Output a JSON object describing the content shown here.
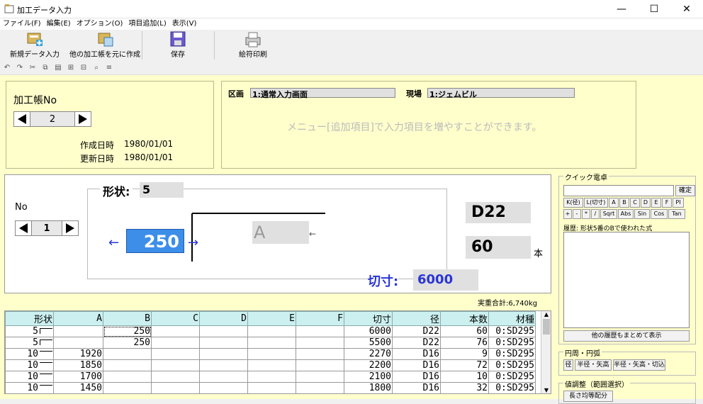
{
  "window": {
    "title": "加工データ入力",
    "minimize": "—",
    "maximize": "☐",
    "close": "✕"
  },
  "menu": [
    "ファイル(F)",
    "編集(E)",
    "オプション(O)",
    "項目追加(L)",
    "表示(V)"
  ],
  "toolbar": {
    "new": "新規データ入力",
    "copy_from": "他の加工帳を元に作成",
    "save": "保存",
    "print": "絵符印刷"
  },
  "header": {
    "label": "加工帳No",
    "number": "2",
    "created_label": "作成日時",
    "created": "1980/01/01",
    "updated_label": "更新日時",
    "updated": "1980/01/01"
  },
  "info": {
    "section_label": "区画",
    "section_value": "1:通常入力画面",
    "site_label": "現場",
    "site_value": "1:ジェムビル",
    "hint": "メニュー[追加項目]で入力項目を増やすことができます。"
  },
  "shape_editor": {
    "no_label": "No",
    "no_value": "1",
    "shape_label": "形状:",
    "shape_value": "5",
    "a_value": "250",
    "b_placeholder": "A",
    "diameter": "D22",
    "count": "60",
    "count_unit": "本",
    "cut_label": "切寸:",
    "cut_value": "6000",
    "weight_total": "実重合計:6,740kg"
  },
  "table": {
    "headers": [
      "形状",
      "A",
      "B",
      "C",
      "D",
      "E",
      "F",
      "切寸",
      "径",
      "本数",
      "材種"
    ],
    "rows": [
      [
        "5",
        "",
        "250",
        "",
        "",
        "",
        "",
        "6000",
        "D22",
        "60",
        "0:SD295"
      ],
      [
        "5",
        "",
        "250",
        "",
        "",
        "",
        "",
        "5500",
        "D22",
        "76",
        "0:SD295"
      ],
      [
        "10",
        "1920",
        "",
        "",
        "",
        "",
        "",
        "2270",
        "D16",
        "9",
        "0:SD295"
      ],
      [
        "10",
        "1850",
        "",
        "",
        "",
        "",
        "",
        "2200",
        "D16",
        "72",
        "0:SD295"
      ],
      [
        "10",
        "1700",
        "",
        "",
        "",
        "",
        "",
        "2100",
        "D16",
        "10",
        "0:SD295"
      ],
      [
        "10",
        "1450",
        "",
        "",
        "",
        "",
        "",
        "1800",
        "D16",
        "32",
        "0:SD295"
      ]
    ]
  },
  "calculator": {
    "title": "クイック電卓",
    "confirm": "確定",
    "row1": [
      "K(径)",
      "L(切寸)",
      "A",
      "B",
      "C",
      "D",
      "E",
      "F",
      "PI"
    ],
    "row2": [
      "+",
      "-",
      "*",
      "/",
      "Sqrt",
      "Abs",
      "Sin",
      "Cos",
      "Tan"
    ],
    "history_label": "履歴: 形状5番のBで使われた式",
    "show_all": "他の履歴もまとめて表示"
  },
  "circle": {
    "title": "円周・円弧",
    "buttons": [
      "径",
      "半径・矢高",
      "半径・矢高・切込"
    ]
  },
  "adjust": {
    "title": "値調整（範囲選択）",
    "button": "長さ均等配分"
  }
}
